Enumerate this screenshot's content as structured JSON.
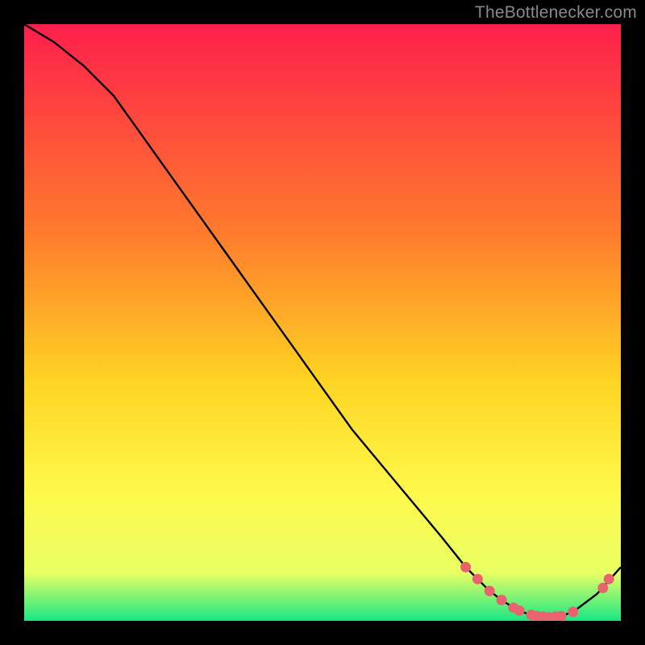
{
  "attribution": "TheBottlenecker.com",
  "chart_data": {
    "type": "line",
    "title": "",
    "xlabel": "",
    "ylabel": "",
    "xlim": [
      0,
      100
    ],
    "ylim": [
      0,
      100
    ],
    "series": [
      {
        "name": "curve",
        "x": [
          0,
          5,
          10,
          15,
          20,
          25,
          30,
          35,
          40,
          45,
          50,
          55,
          60,
          65,
          70,
          74,
          78,
          80,
          82,
          84,
          86,
          88,
          90,
          92,
          96,
          100
        ],
        "y": [
          100,
          97,
          93,
          88,
          81,
          74,
          67,
          60,
          53,
          46,
          39,
          32,
          26,
          20,
          14,
          9,
          5,
          3.5,
          2.2,
          1.3,
          0.8,
          0.6,
          0.8,
          1.5,
          4.5,
          9
        ]
      }
    ],
    "markers": [
      {
        "x": 74,
        "y": 9
      },
      {
        "x": 76,
        "y": 7
      },
      {
        "x": 78,
        "y": 5
      },
      {
        "x": 80,
        "y": 3.5
      },
      {
        "x": 82,
        "y": 2.2
      },
      {
        "x": 83,
        "y": 1.7
      },
      {
        "x": 85,
        "y": 1.0
      },
      {
        "x": 86,
        "y": 0.8
      },
      {
        "x": 87,
        "y": 0.7
      },
      {
        "x": 88,
        "y": 0.6
      },
      {
        "x": 89,
        "y": 0.7
      },
      {
        "x": 90,
        "y": 0.8
      },
      {
        "x": 92,
        "y": 1.5
      },
      {
        "x": 97,
        "y": 5.5
      },
      {
        "x": 98,
        "y": 7
      }
    ],
    "colors": {
      "gradient_top": "#ff1f4b",
      "gradient_mid1": "#ff7b2d",
      "gradient_mid2": "#ffd422",
      "gradient_mid3": "#fff84a",
      "gradient_mid4": "#e8ff63",
      "gradient_bot": "#17e884",
      "marker": "#e9636e",
      "curve": "#000000"
    }
  }
}
